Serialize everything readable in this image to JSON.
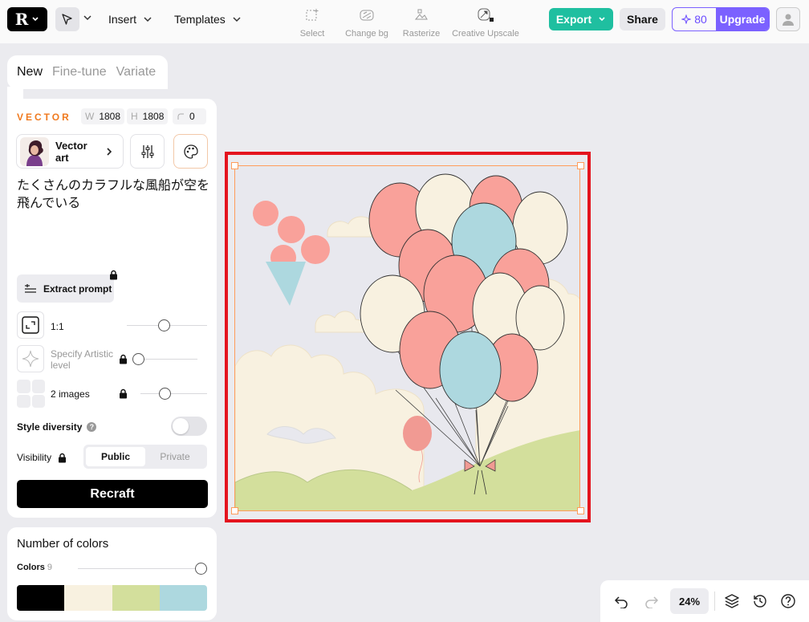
{
  "header": {
    "menus": [
      "Insert",
      "Templates"
    ],
    "tools": [
      {
        "label": "Select",
        "icon": "select-icon"
      },
      {
        "label": "Change bg",
        "icon": "change-bg-icon"
      },
      {
        "label": "Rasterize",
        "icon": "rasterize-icon"
      },
      {
        "label": "Creative Upscale",
        "icon": "creative-upscale-icon"
      }
    ],
    "export_label": "Export",
    "share_label": "Share",
    "credits": "80",
    "upgrade_label": "Upgrade"
  },
  "mode_tabs": [
    "New",
    "Fine-tune",
    "Variate"
  ],
  "panel": {
    "type_label": "VECTOR",
    "width": {
      "key": "W",
      "value": "1808"
    },
    "height": {
      "key": "H",
      "value": "1808"
    },
    "corner": "0",
    "style_name": "Vector art",
    "prompt": "たくさんのカラフルな風船が空を飛んでいる",
    "extract_label": "Extract prompt",
    "ratio_label": "1:1",
    "artistic_label": "Specify Artistic level",
    "images_label": "2 images",
    "diversity_label": "Style diversity",
    "visibility_label": "Visibility",
    "visibility_options": [
      "Public",
      "Private"
    ],
    "visibility_selected": "Public",
    "recraft_label": "Recraft"
  },
  "colors_panel": {
    "title": "Number of colors",
    "colors_label": "Colors",
    "colors_count": "9",
    "swatches": [
      "#000000",
      "#f8f1e0",
      "#d3df9c",
      "#add8df"
    ]
  },
  "bottom_bar": {
    "zoom": "24%"
  }
}
